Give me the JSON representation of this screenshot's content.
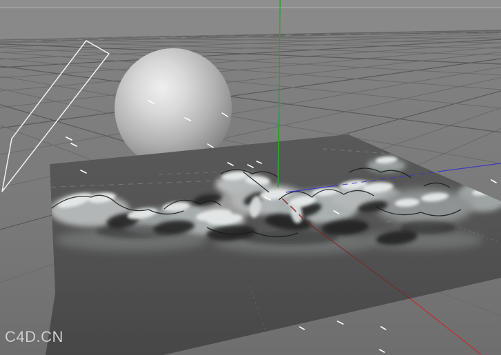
{
  "viewport": {
    "watermark": "C4D.CN"
  },
  "colors": {
    "axis_y_green": "#2f9e2f",
    "axis_z_blue": "#3b3bc0",
    "axis_x_red_bright": "#c03030",
    "axis_x_red_dim": "#7a2828",
    "axis_x_red_hidden": "#8b2a2a",
    "wireframe_white": "#f2f2f2",
    "tick_white": "#ffffff",
    "sky_gray": "#8a8a8a",
    "plane_dark_gray": "#515151",
    "ground_gray": "#747474"
  }
}
